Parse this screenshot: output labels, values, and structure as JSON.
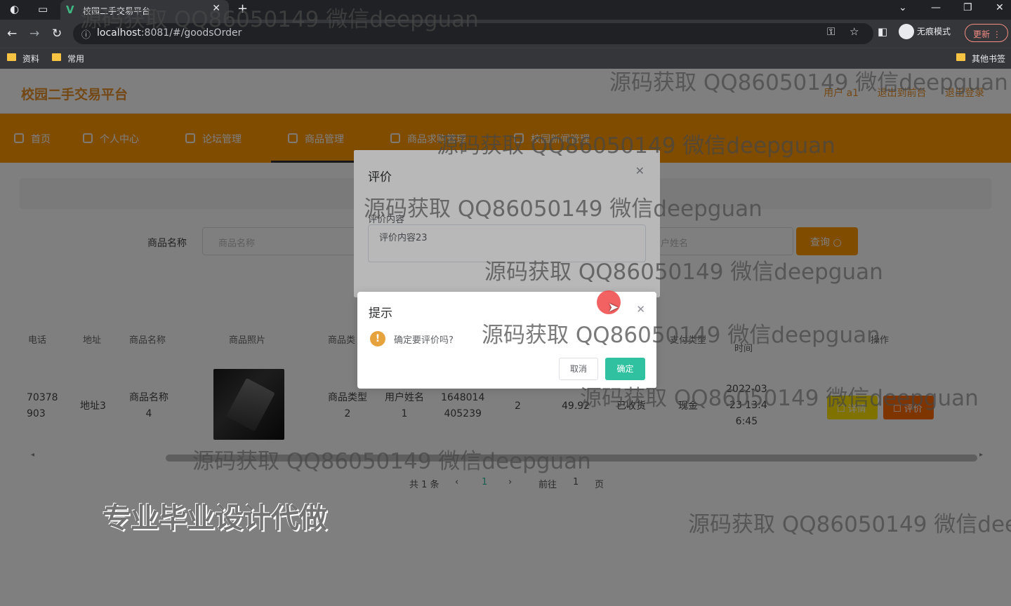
{
  "browser": {
    "tab_title": "校园二手交易平台",
    "url_host": "localhost",
    "url_rest": ":8081/#/goodsOrder",
    "incognito_label": "无痕模式",
    "update_label": "更新",
    "bookmarks": [
      "资料",
      "常用"
    ],
    "other_bookmarks": "其他书签"
  },
  "app": {
    "brand": "校园二手交易平台",
    "header_links": [
      "用户 a1",
      "退出到前台",
      "退出登录"
    ],
    "menu": [
      "首页",
      "个人中心",
      "论坛管理",
      "商品管理",
      "商品求购管理",
      "校园新闻管理"
    ],
    "active_menu": "商品管理"
  },
  "search": {
    "label": "商品名称",
    "placeholder": "商品名称",
    "placeholder2": "户姓名",
    "query_label": "查询"
  },
  "table": {
    "headers": [
      "电话",
      "地址",
      "商品名称",
      "商品照片",
      "商品类",
      "支付类型",
      "时间",
      "操作"
    ],
    "row": {
      "phone": "70378\n903",
      "address": "地址3",
      "goods_name": "商品名称\n4",
      "goods_type": "商品类型\n2",
      "user_name": "用户姓名\n1",
      "order_no": "1648014\n405239",
      "quantity": "2",
      "price": "49.92",
      "status": "已收货",
      "pay_type": "现金",
      "time": "2022-03\n-23 13:4\n6:45",
      "detail_label": "详情",
      "review_label": "评价"
    }
  },
  "pager": {
    "total": "共 1 条",
    "current": "1",
    "goto_label": "前往",
    "goto_value": "1",
    "page_unit": "页"
  },
  "review_dialog": {
    "title": "评价",
    "field_label": "评价内容",
    "content": "评价内容23"
  },
  "confirm": {
    "title": "提示",
    "message": "确定要评价吗?",
    "cancel_label": "取消",
    "ok_label": "确定"
  },
  "watermark": {
    "text": "源码获取 QQ86050149 微信deepguan",
    "text_cut": "源码获取 QQ86050149 微信deep",
    "slogan": "专业毕业设计代做"
  },
  "colors": {
    "primary": "#ff9900",
    "confirm": "#2fc1a0",
    "warning": "#e6a23c",
    "detail_btn": "#ffe400",
    "review_btn": "#ff6a00"
  }
}
